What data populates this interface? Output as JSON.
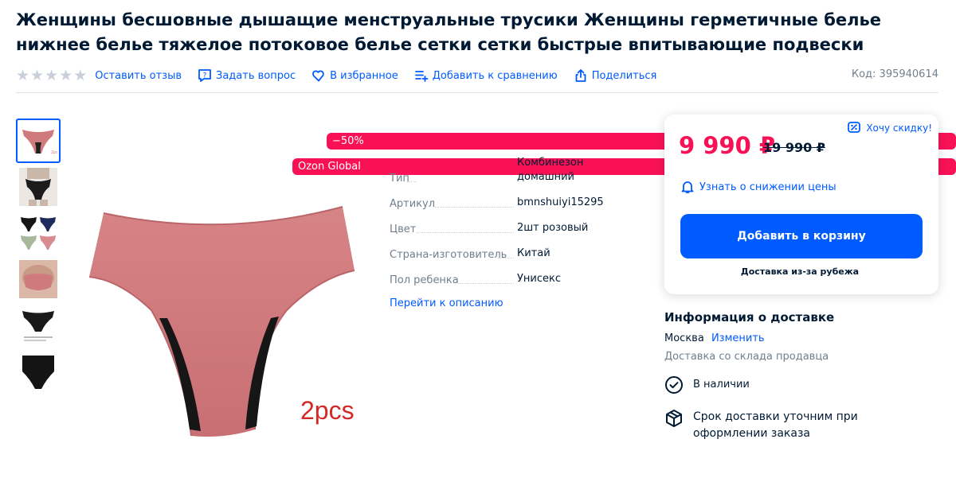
{
  "product": {
    "title": "Женщины бесшовные дышащие менструальные трусики Женщины герметичные белье нижнее белье тяжелое потоковое белье сетки сетки быстрые впитывающие подвески",
    "code_label": "Код: 395940614",
    "badge_discount": "−50%",
    "badge_seller": "Ozon Global",
    "image_caption": "2pcs"
  },
  "actions": {
    "review": "Оставить отзыв",
    "question": "Задать вопрос",
    "favorite": "В избранное",
    "compare": "Добавить к сравнению",
    "share": "Поделиться",
    "rating_stars": 0
  },
  "characteristics": [
    {
      "key": "Тип",
      "value": "Комбинезон домашний"
    },
    {
      "key": "Артикул",
      "value": "bmnshuiyi15295"
    },
    {
      "key": "Цвет",
      "value": "2шт розовый"
    },
    {
      "key": "Страна-изготовитель",
      "value": "Китай"
    },
    {
      "key": "Пол ребенка",
      "value": "Унисекс"
    }
  ],
  "to_description": "Перейти к описанию",
  "buybox": {
    "want_discount": "Хочу скидку!",
    "price": "9 990 ₽",
    "old_price": "19 990 ₽",
    "notify": "Узнать о снижении цены",
    "cart_button": "Добавить в корзину",
    "abroad": "Доставка из-за рубежа"
  },
  "delivery": {
    "title": "Информация о доставке",
    "city": "Москва",
    "change": "Изменить",
    "warehouse": "Доставка со склада продавца",
    "in_stock": "В наличии",
    "term": "Срок доставки уточним при оформлении заказа"
  },
  "colors": {
    "accent": "#005bff",
    "price": "#f91155",
    "product_pink": "#d07a7d"
  }
}
